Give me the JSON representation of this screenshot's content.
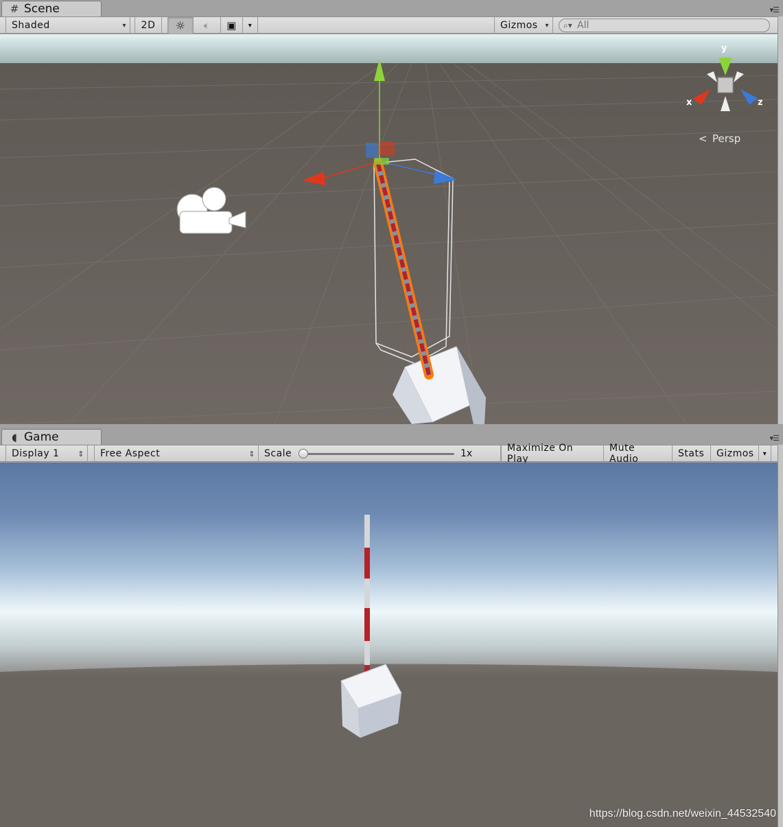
{
  "scene_panel": {
    "tab_label": "Scene",
    "tab_icon": "hash-icon",
    "toolbar": {
      "draw_mode": "Shaded",
      "mode_2d": "2D",
      "gizmos_label": "Gizmos",
      "search_placeholder": "All"
    },
    "orientation_gizmo": {
      "y_label": "y",
      "x_label": "x",
      "z_label": "z",
      "projection_label": "Persp"
    }
  },
  "game_panel": {
    "tab_label": "Game",
    "tab_icon": "pacman-icon",
    "toolbar": {
      "display": "Display 1",
      "aspect": "Free Aspect",
      "scale_label": "Scale",
      "scale_value": "1x",
      "scale_level": 0.0,
      "maximize_on_play": "Maximize On Play",
      "mute_audio": "Mute Audio",
      "stats": "Stats",
      "gizmos_label": "Gizmos"
    }
  },
  "colors": {
    "scene_ground": "#6b6560",
    "scene_sky": "#d6eef0",
    "game_sky_top": "#5c7aa3",
    "game_horizon": "#e8f4f8",
    "game_ground": "#6b6560",
    "axis_x": "#e0371c",
    "axis_y": "#8cd43a",
    "axis_z": "#3b7ad9",
    "selection_outline": "#ff7a00",
    "pole_red": "#b4222a"
  },
  "watermark": "https://blog.csdn.net/weixin_44532540"
}
